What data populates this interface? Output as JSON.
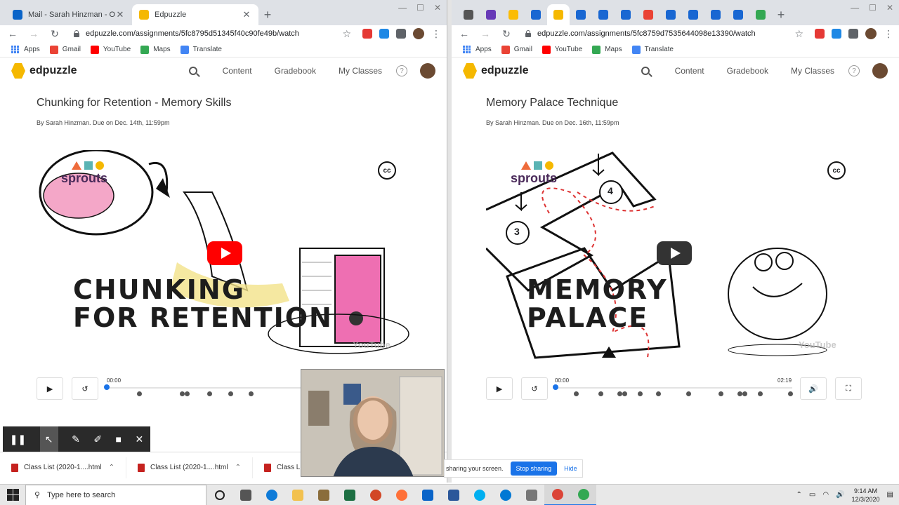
{
  "left": {
    "tabs": [
      {
        "title": "Mail - Sarah Hinzman - Outlook",
        "color": "#0a64c8"
      },
      {
        "title": "Edpuzzle",
        "color": "#f5b800",
        "active": true
      }
    ],
    "url": "edpuzzle.com/assignments/5fc8795d51345f40c90fe49b/watch",
    "assignment": {
      "title": "Chunking for Retention - Memory Skills",
      "meta": "By Sarah Hinzman. Due on Dec. 14th, 11:59pm",
      "video_text_line1": "CHUNKING",
      "video_text_line2": "FOR RETENTION",
      "time_current": "00:00",
      "time_total": ""
    }
  },
  "right": {
    "url": "edpuzzle.com/assignments/5fc8759d7535644098e13390/watch",
    "assignment": {
      "title": "Memory Palace Technique",
      "meta": "By Sarah Hinzman. Due on Dec. 16th, 11:59pm",
      "video_text_line1": "MEMORY",
      "video_text_line2": "PALACE",
      "time_current": "00:00",
      "time_total": "02:19"
    },
    "room_labels": [
      "4",
      "3"
    ]
  },
  "bookmarks": {
    "apps": "Apps",
    "gmail": "Gmail",
    "youtube": "YouTube",
    "maps": "Maps",
    "translate": "Translate"
  },
  "edpuzzle_nav": {
    "logo": "edpuzzle",
    "content": "Content",
    "gradebook": "Gradebook",
    "my_classes": "My Classes",
    "help": "?"
  },
  "video_overlay": {
    "brand": "sprouts",
    "cc": "cc",
    "watermark": "YouTube"
  },
  "downloads": [
    {
      "name": "Class List (2020-1....html"
    },
    {
      "name": "Class List (2020-1....html"
    },
    {
      "name": "Class List"
    }
  ],
  "sharing": {
    "message": "sharing your screen.",
    "stop": "Stop sharing",
    "hide": "Hide"
  },
  "taskbar": {
    "search_placeholder": "Type here to search",
    "time": "9:14 AM",
    "date": "12/3/2020"
  },
  "colors": {
    "accent": "#1a73e8",
    "edpuzzle_yellow": "#f5b800",
    "youtube_red": "#ff0000"
  }
}
